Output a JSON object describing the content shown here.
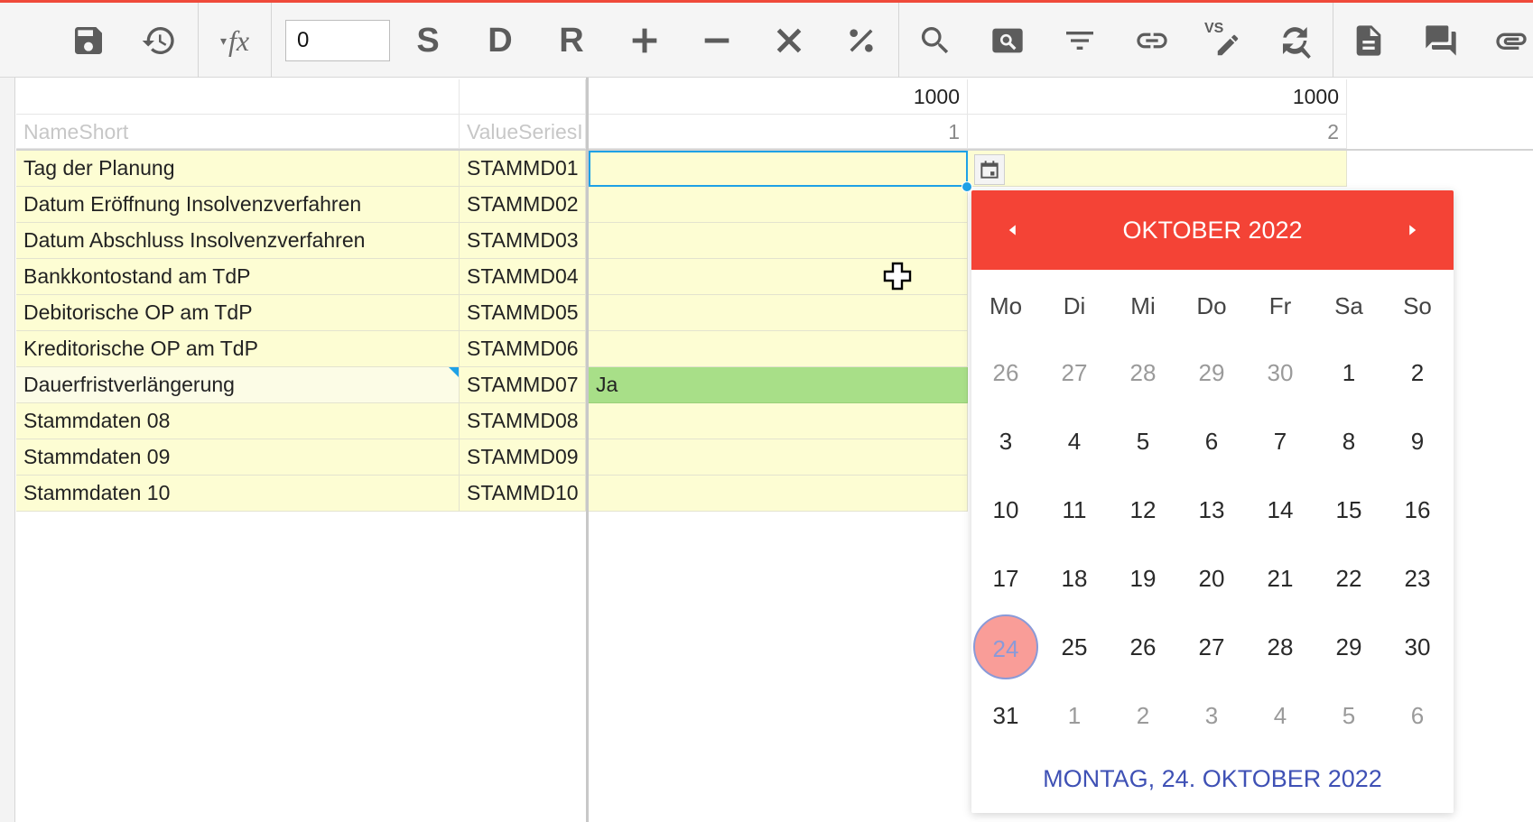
{
  "toolbar": {
    "number_value": "0",
    "fx_label": "fx",
    "letters": {
      "s": "S",
      "d": "D",
      "r": "R"
    },
    "vs_label": "VS"
  },
  "grid": {
    "header_row1": {
      "col3": "1000",
      "col4": "1000"
    },
    "header_row2": {
      "col1": "NameShort",
      "col2": "ValueSeriesI",
      "col3": "1",
      "col4": "2"
    },
    "rows": [
      {
        "name": "Tag der Planung",
        "code": "STAMMD01",
        "value": ""
      },
      {
        "name": "Datum Eröffnung Insolvenzverfahren",
        "code": "STAMMD02",
        "value": ""
      },
      {
        "name": "Datum Abschluss Insolvenzverfahren",
        "code": "STAMMD03",
        "value": ""
      },
      {
        "name": "Bankkontostand am TdP",
        "code": "STAMMD04",
        "value": ""
      },
      {
        "name": "Debitorische OP am TdP",
        "code": "STAMMD05",
        "value": ""
      },
      {
        "name": "Kreditorische OP am TdP",
        "code": "STAMMD06",
        "value": ""
      },
      {
        "name": "Dauerfristverlängerung",
        "code": "STAMMD07",
        "value": "Ja"
      },
      {
        "name": "Stammdaten 08",
        "code": "STAMMD08",
        "value": ""
      },
      {
        "name": "Stammdaten 09",
        "code": "STAMMD09",
        "value": ""
      },
      {
        "name": "Stammdaten 10",
        "code": "STAMMD10",
        "value": ""
      }
    ]
  },
  "calendar": {
    "title": "OKTOBER 2022",
    "weekdays": [
      "Mo",
      "Di",
      "Mi",
      "Do",
      "Fr",
      "Sa",
      "So"
    ],
    "weeks": [
      [
        "26",
        "27",
        "28",
        "29",
        "30",
        "1",
        "2"
      ],
      [
        "3",
        "4",
        "5",
        "6",
        "7",
        "8",
        "9"
      ],
      [
        "10",
        "11",
        "12",
        "13",
        "14",
        "15",
        "16"
      ],
      [
        "17",
        "18",
        "19",
        "20",
        "21",
        "22",
        "23"
      ],
      [
        "24",
        "25",
        "26",
        "27",
        "28",
        "29",
        "30"
      ],
      [
        "31",
        "1",
        "2",
        "3",
        "4",
        "5",
        "6"
      ]
    ],
    "selected_day": "24",
    "footer": "MONTAG, 24. OKTOBER 2022",
    "accent": "#f44336",
    "footer_color": "#3f51b5"
  },
  "colors": {
    "row_fill": "#fdfdd3",
    "value_fill": "#a8df88",
    "selection": "#1ea1e6",
    "top_line": "#ef4a3a"
  }
}
